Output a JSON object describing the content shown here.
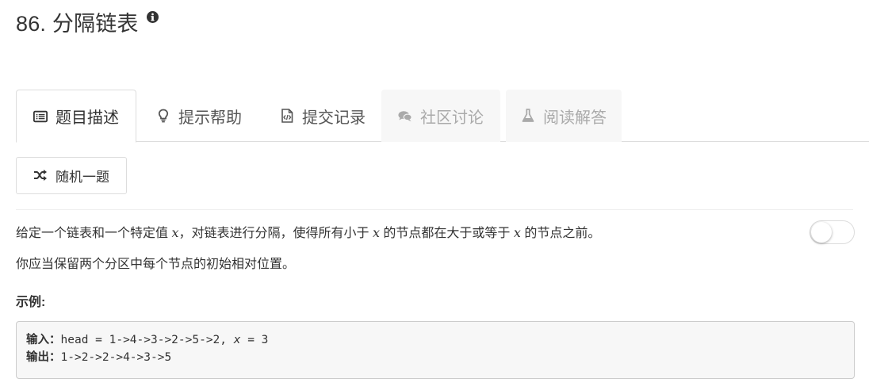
{
  "header": {
    "title": "86. 分隔链表",
    "info_icon": "info-circle-icon"
  },
  "tabs": [
    {
      "label": "题目描述",
      "icon": "list-icon",
      "state": "active"
    },
    {
      "label": "提示帮助",
      "icon": "lightbulb-icon",
      "state": "normal"
    },
    {
      "label": "提交记录",
      "icon": "code-file-icon",
      "state": "normal"
    },
    {
      "label": "社区讨论",
      "icon": "comments-icon",
      "state": "disabled"
    },
    {
      "label": "阅读解答",
      "icon": "flask-icon",
      "state": "disabled"
    }
  ],
  "random_button": {
    "label": "随机一题",
    "icon": "shuffle-icon"
  },
  "description": {
    "p1": {
      "a": "给定一个链表和一个特定值 ",
      "x1": "x",
      "b": "，对链表进行分隔，使得所有小于 ",
      "x2": "x",
      "c": " 的节点都在大于或等于 ",
      "x3": "x",
      "d": " 的节点之前。"
    },
    "p2": "你应当保留两个分区中每个节点的初始相对位置。",
    "example_label": "示例:",
    "input_label": "输入",
    "input_value_a": "head = 1->4->3->2->5->2, ",
    "input_value_x": "x",
    "input_value_b": " = 3",
    "output_label": "输出",
    "output_value": "1->2->2->4->3->5",
    "colon": "："
  },
  "toggle": {
    "on": false
  },
  "colors": {
    "border": "#dddddd",
    "disabled_text": "#aaaaaa",
    "code_bg": "#f7f7f7"
  }
}
